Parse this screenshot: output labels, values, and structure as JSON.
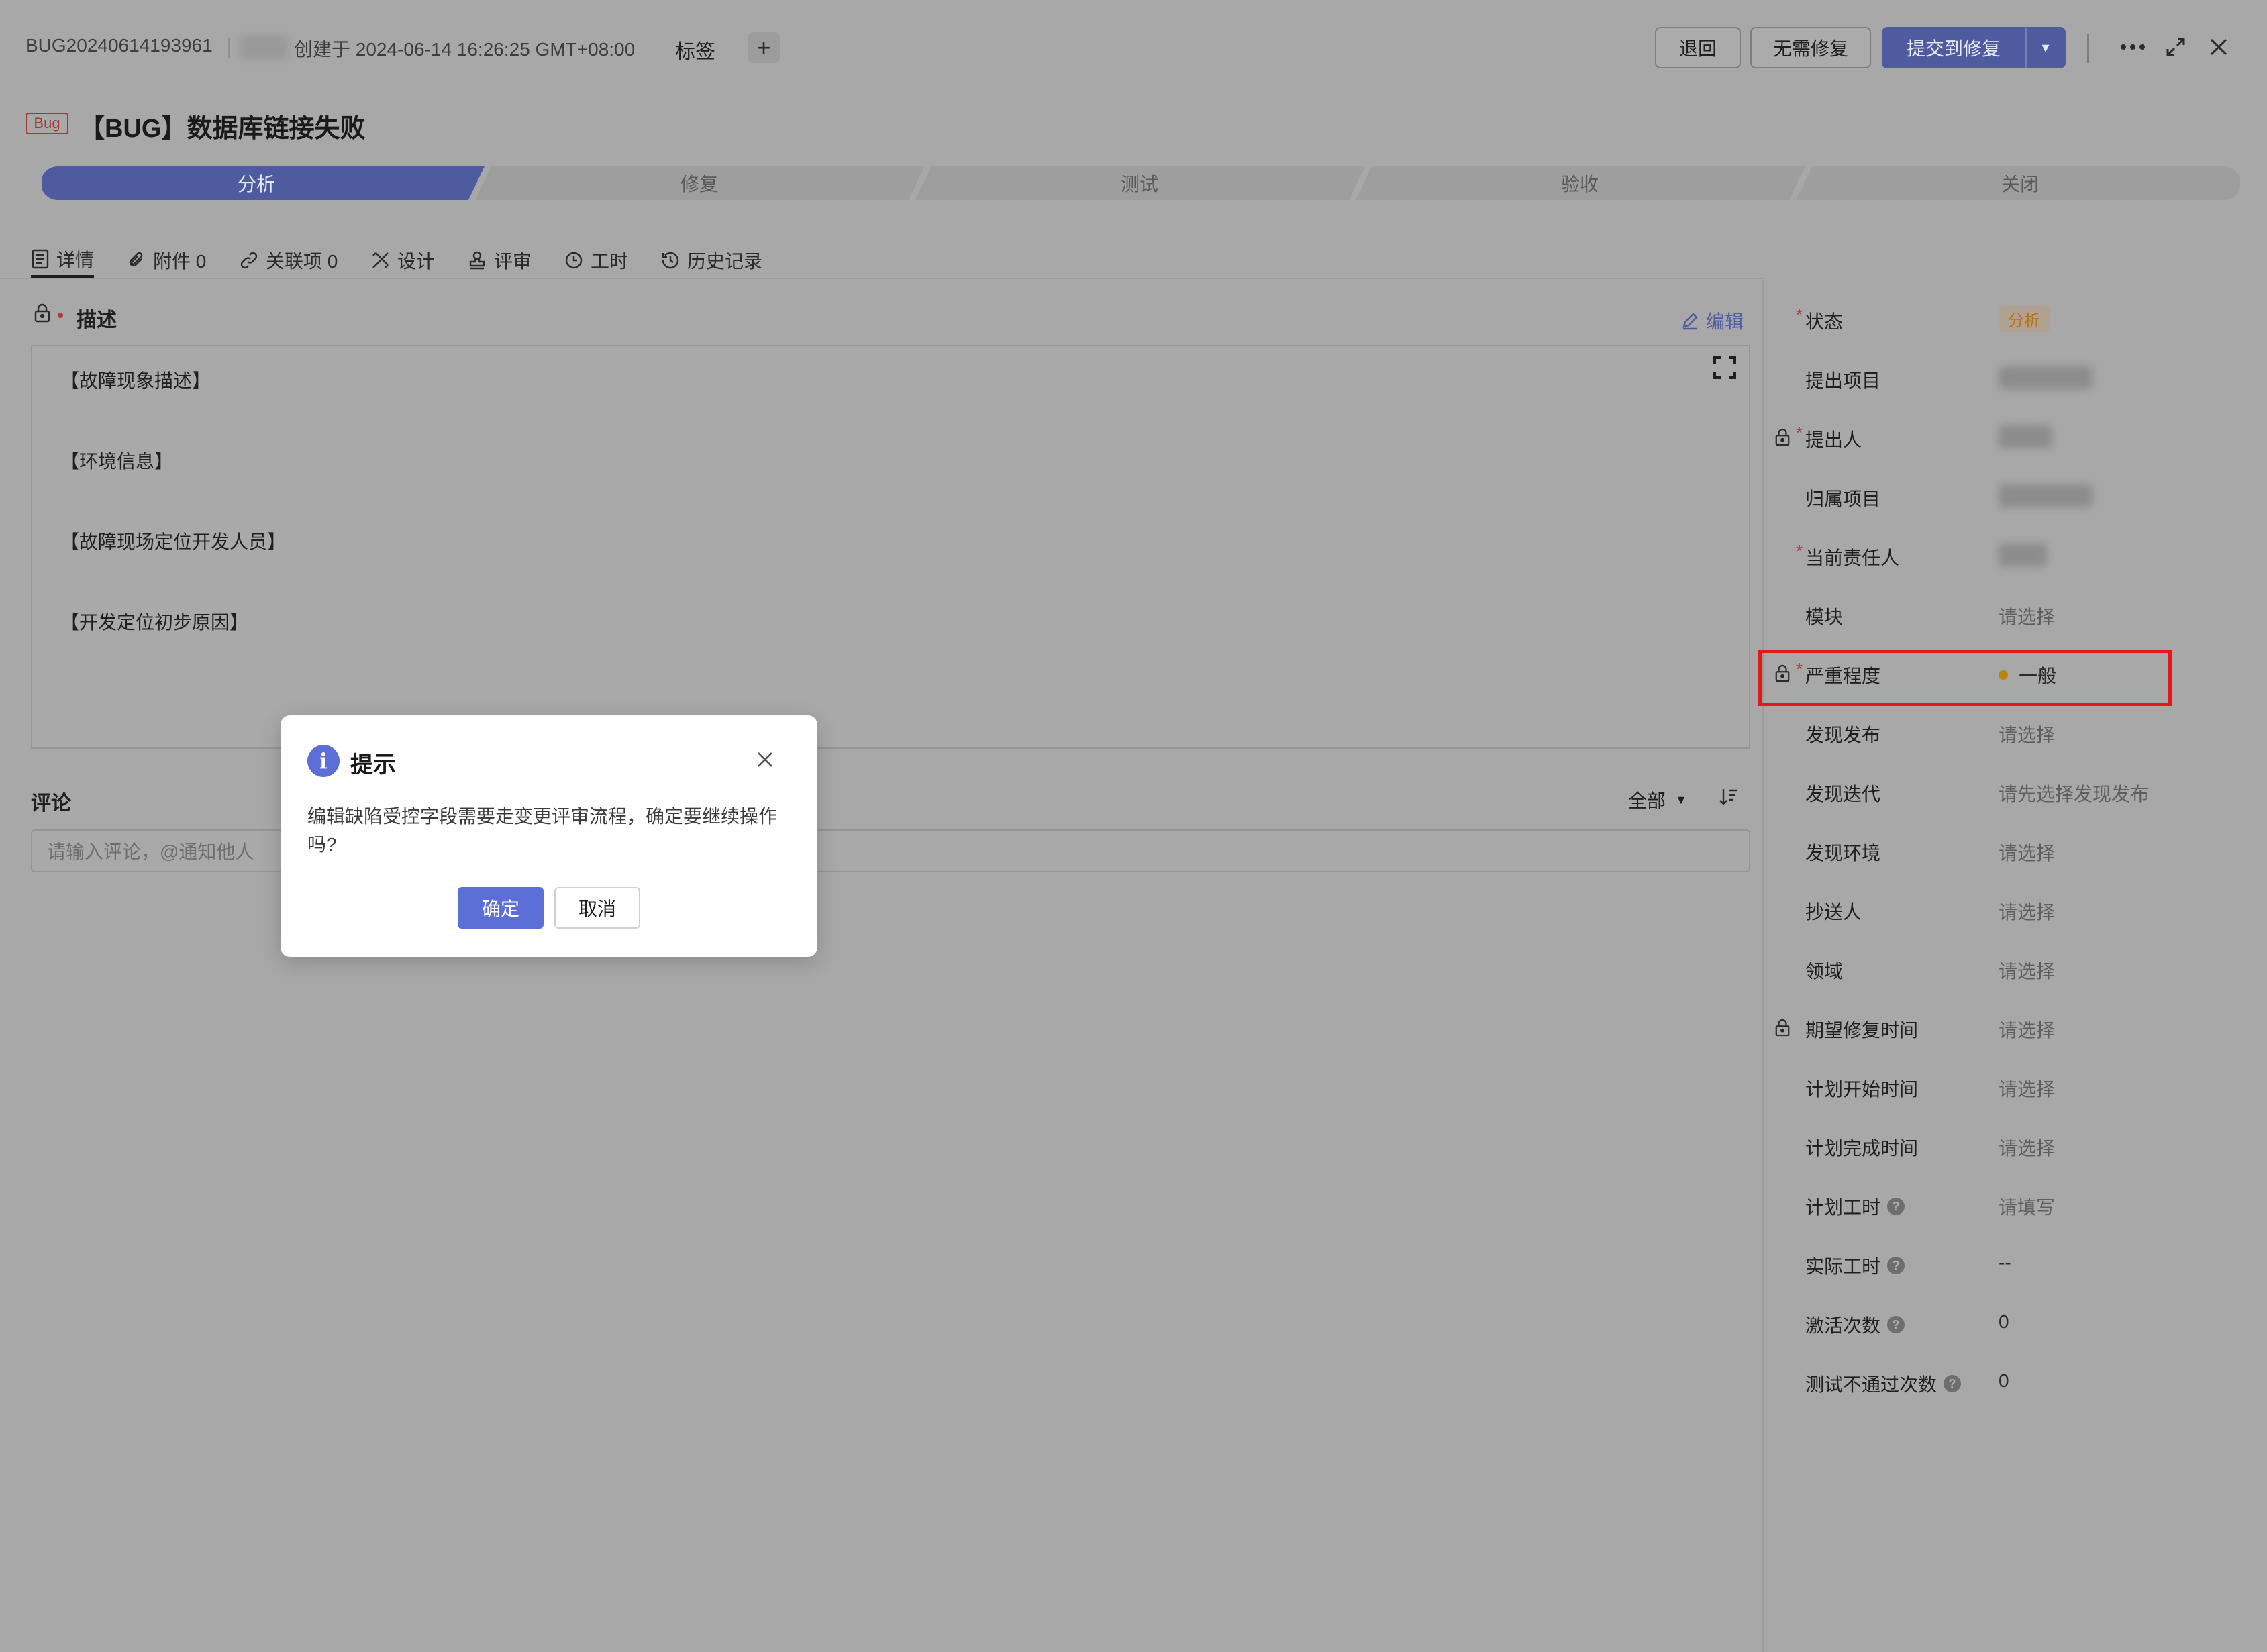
{
  "header": {
    "bug_id": "BUG20240614193961",
    "created_text": "创建于 2024-06-14 16:26:25 GMT+08:00",
    "tag_label": "标签",
    "tag_add": "+",
    "buttons": {
      "back": "退回",
      "no_fix": "无需修复",
      "submit": "提交到修复",
      "submit_dropdown": "▾"
    },
    "icons": [
      "more-icon",
      "expand-icon",
      "close-icon"
    ]
  },
  "title": {
    "badge": "Bug",
    "text": "【BUG】数据库链接失败"
  },
  "workflow": {
    "active_index": 0,
    "steps": [
      "分析",
      "修复",
      "测试",
      "验收",
      "关闭"
    ]
  },
  "tabs": [
    {
      "label": "详情",
      "icon": "detail-icon",
      "active": true
    },
    {
      "label": "附件 0",
      "icon": "paperclip-icon"
    },
    {
      "label": "关联项 0",
      "icon": "link-icon"
    },
    {
      "label": "设计",
      "icon": "design-icon"
    },
    {
      "label": "评审",
      "icon": "stamp-icon"
    },
    {
      "label": "工时",
      "icon": "clock-icon"
    },
    {
      "label": "历史记录",
      "icon": "history-icon"
    }
  ],
  "description": {
    "title": "描述",
    "edit_label": "编辑",
    "lines": [
      "【故障现象描述】",
      "【环境信息】",
      "【故障现场定位开发人员】",
      "【开发定位初步原因】"
    ]
  },
  "comments": {
    "title": "评论",
    "filter": "全部",
    "placeholder": "请输入评论，@通知他人"
  },
  "fields": [
    {
      "label": "状态",
      "required": true,
      "value": "分析",
      "kind": "status"
    },
    {
      "label": "提出项目",
      "value": "",
      "kind": "blurred"
    },
    {
      "label": "提出人",
      "required": true,
      "locked": true,
      "value": "",
      "kind": "blurred"
    },
    {
      "label": "归属项目",
      "value": "",
      "kind": "blurred"
    },
    {
      "label": "当前责任人",
      "required": true,
      "value": "",
      "kind": "blurred"
    },
    {
      "label": "模块",
      "value": "请选择",
      "kind": "placeholder"
    },
    {
      "label": "严重程度",
      "required": true,
      "locked": true,
      "value": "一般",
      "kind": "severity",
      "highlighted": true
    },
    {
      "label": "发现发布",
      "value": "请选择",
      "kind": "placeholder"
    },
    {
      "label": "发现迭代",
      "value": "请先选择发现发布",
      "kind": "placeholder"
    },
    {
      "label": "发现环境",
      "value": "请选择",
      "kind": "placeholder"
    },
    {
      "label": "抄送人",
      "value": "请选择",
      "kind": "placeholder"
    },
    {
      "label": "领域",
      "value": "请选择",
      "kind": "placeholder"
    },
    {
      "label": "期望修复时间",
      "locked": true,
      "value": "请选择",
      "kind": "placeholder"
    },
    {
      "label": "计划开始时间",
      "value": "请选择",
      "kind": "placeholder"
    },
    {
      "label": "计划完成时间",
      "value": "请选择",
      "kind": "placeholder"
    },
    {
      "label": "计划工时",
      "help": true,
      "value": "请填写",
      "kind": "placeholder"
    },
    {
      "label": "实际工时",
      "help": true,
      "value": "--",
      "kind": "text"
    },
    {
      "label": "激活次数",
      "help": true,
      "value": "0",
      "kind": "text"
    },
    {
      "label": "测试不通过次数",
      "help": true,
      "value": "0",
      "kind": "text"
    }
  ],
  "modal": {
    "icon": "info-icon",
    "title": "提示",
    "message": "编辑缺陷受控字段需要走变更评审流程，确定要继续操作吗?",
    "ok": "确定",
    "cancel": "取消"
  },
  "colors": {
    "overlay_bg": "#a8a8a8",
    "accent": "#5b6fd6",
    "accent_dimmed": "#4e5b9f",
    "highlight_border": "#e8161a",
    "status_text": "#b8720f",
    "severity_dot": "#b8860b"
  }
}
